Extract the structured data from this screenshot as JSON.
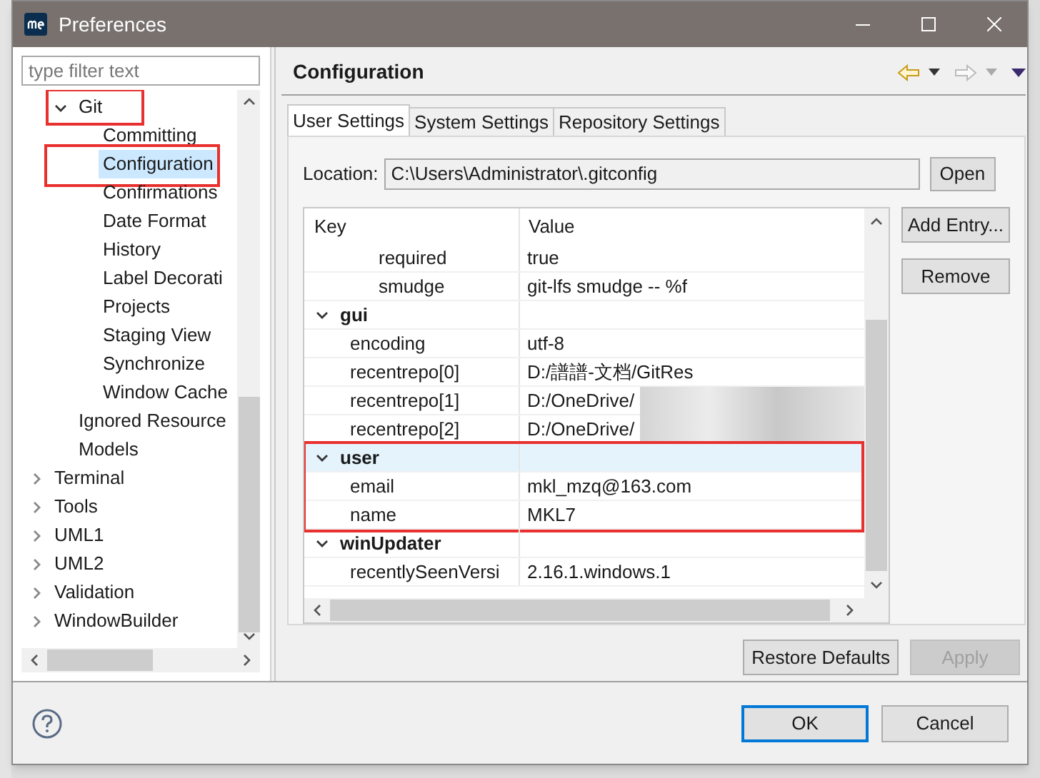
{
  "window": {
    "title": "Preferences"
  },
  "filter": {
    "placeholder": "type filter text"
  },
  "tree": {
    "items": [
      {
        "children": [
          {
            "label": "Git",
            "expanded": true,
            "selected": false,
            "highlighted": true,
            "children": [
              {
                "label": "Committing",
                "selected": false
              },
              {
                "label": "Configuration",
                "selected": true,
                "highlighted": true
              },
              {
                "label": "Confirmations",
                "selected": false
              },
              {
                "label": "Date Format",
                "selected": false
              },
              {
                "label": "History",
                "selected": false
              },
              {
                "label": "Label Decorati",
                "selected": false
              },
              {
                "label": "Projects",
                "selected": false
              },
              {
                "label": "Staging View",
                "selected": false
              },
              {
                "label": "Synchronize",
                "selected": false
              },
              {
                "label": "Window Cache",
                "selected": false
              }
            ]
          },
          {
            "label": "Ignored Resource",
            "selected": false
          },
          {
            "label": "Models",
            "selected": false
          }
        ]
      },
      {
        "label": "Terminal",
        "expanded": false,
        "selected": false
      },
      {
        "label": "Tools",
        "expanded": false,
        "selected": false
      },
      {
        "label": "UML1",
        "expanded": false,
        "selected": false
      },
      {
        "label": "UML2",
        "expanded": false,
        "selected": false
      },
      {
        "label": "Validation",
        "expanded": false,
        "selected": false
      },
      {
        "label": "WindowBuilder",
        "expanded": false,
        "selected": false
      }
    ]
  },
  "page": {
    "title": "Configuration"
  },
  "tabs": [
    {
      "label": "User Settings",
      "selected": true
    },
    {
      "label": "System Settings",
      "selected": false
    },
    {
      "label": "Repository Settings",
      "selected": false
    }
  ],
  "location": {
    "label": "Location:",
    "value": "C:\\Users\\Administrator\\.gitconfig",
    "button": "Open"
  },
  "table": {
    "columns": [
      "Key",
      "Value"
    ],
    "rows": [
      {
        "children": [
          {
            "children": [
              {
                "key": "required",
                "value": "true",
                "selected": false
              },
              {
                "key": "smudge",
                "value": "git-lfs smudge -- %f",
                "selected": false
              }
            ]
          }
        ]
      },
      {
        "key": "gui",
        "expanded": true,
        "selected": false,
        "children": [
          {
            "key": "encoding",
            "value": "utf-8",
            "selected": false
          },
          {
            "key": "recentrepo[0]",
            "value": "D:/譜譜-文档/GitRes",
            "selected": false
          },
          {
            "key": "recentrepo[1]",
            "value": "D:/OneDrive/",
            "redacted": true,
            "selected": false
          },
          {
            "key": "recentrepo[2]",
            "value": "D:/OneDrive/",
            "redacted": true,
            "selected": false
          }
        ]
      },
      {
        "key": "user",
        "expanded": true,
        "selected": true,
        "highlighted": true,
        "children": [
          {
            "key": "email",
            "value": "mkl_mzq@163.com",
            "selected": false
          },
          {
            "key": "name",
            "value": "MKL7",
            "selected": false
          }
        ]
      },
      {
        "key": "winUpdater",
        "expanded": true,
        "selected": false,
        "children": [
          {
            "key": "recentlySeenVersi",
            "value": "2.16.1.windows.1",
            "selected": false
          }
        ]
      }
    ]
  },
  "side_buttons": [
    {
      "label": "Add Entry...",
      "disabled": false
    },
    {
      "label": "Remove",
      "disabled": false
    }
  ],
  "page_buttons": [
    {
      "label": "Restore Defaults",
      "disabled": false
    },
    {
      "label": "Apply",
      "disabled": true
    }
  ],
  "dialog_buttons": [
    {
      "label": "OK",
      "default": true
    },
    {
      "label": "Cancel",
      "default": false
    }
  ]
}
